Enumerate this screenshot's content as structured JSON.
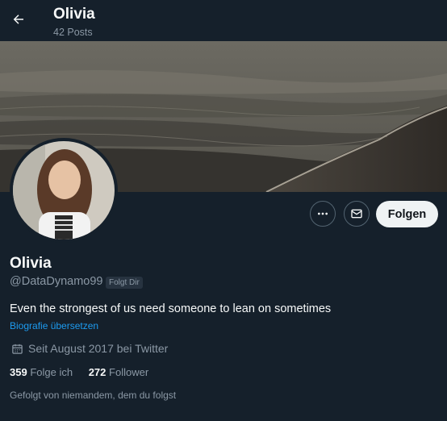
{
  "header": {
    "title": "Olivia",
    "posts_count": "42 Posts"
  },
  "actions": {
    "follow_label": "Folgen"
  },
  "profile": {
    "name": "Olivia",
    "handle": "@DataDynamo99",
    "follows_you_badge": "Folgt Dir",
    "bio": "Even the strongest of us need someone to lean on sometimes",
    "translate_bio": "Biografie übersetzen",
    "joined": "Seit August 2017 bei Twitter",
    "following_count": "359",
    "following_label": "Folge ich",
    "followers_count": "272",
    "followers_label": "Follower",
    "followed_by": "Gefolgt von niemandem, dem du folgst"
  },
  "icons": {
    "back": "arrow-left-icon",
    "more": "more-dots-icon",
    "message": "envelope-icon",
    "calendar": "calendar-icon"
  },
  "colors": {
    "background": "#15202b",
    "link": "#1d9bf0",
    "secondary_text": "#8b98a5",
    "follow_button": "#eff3f4"
  }
}
